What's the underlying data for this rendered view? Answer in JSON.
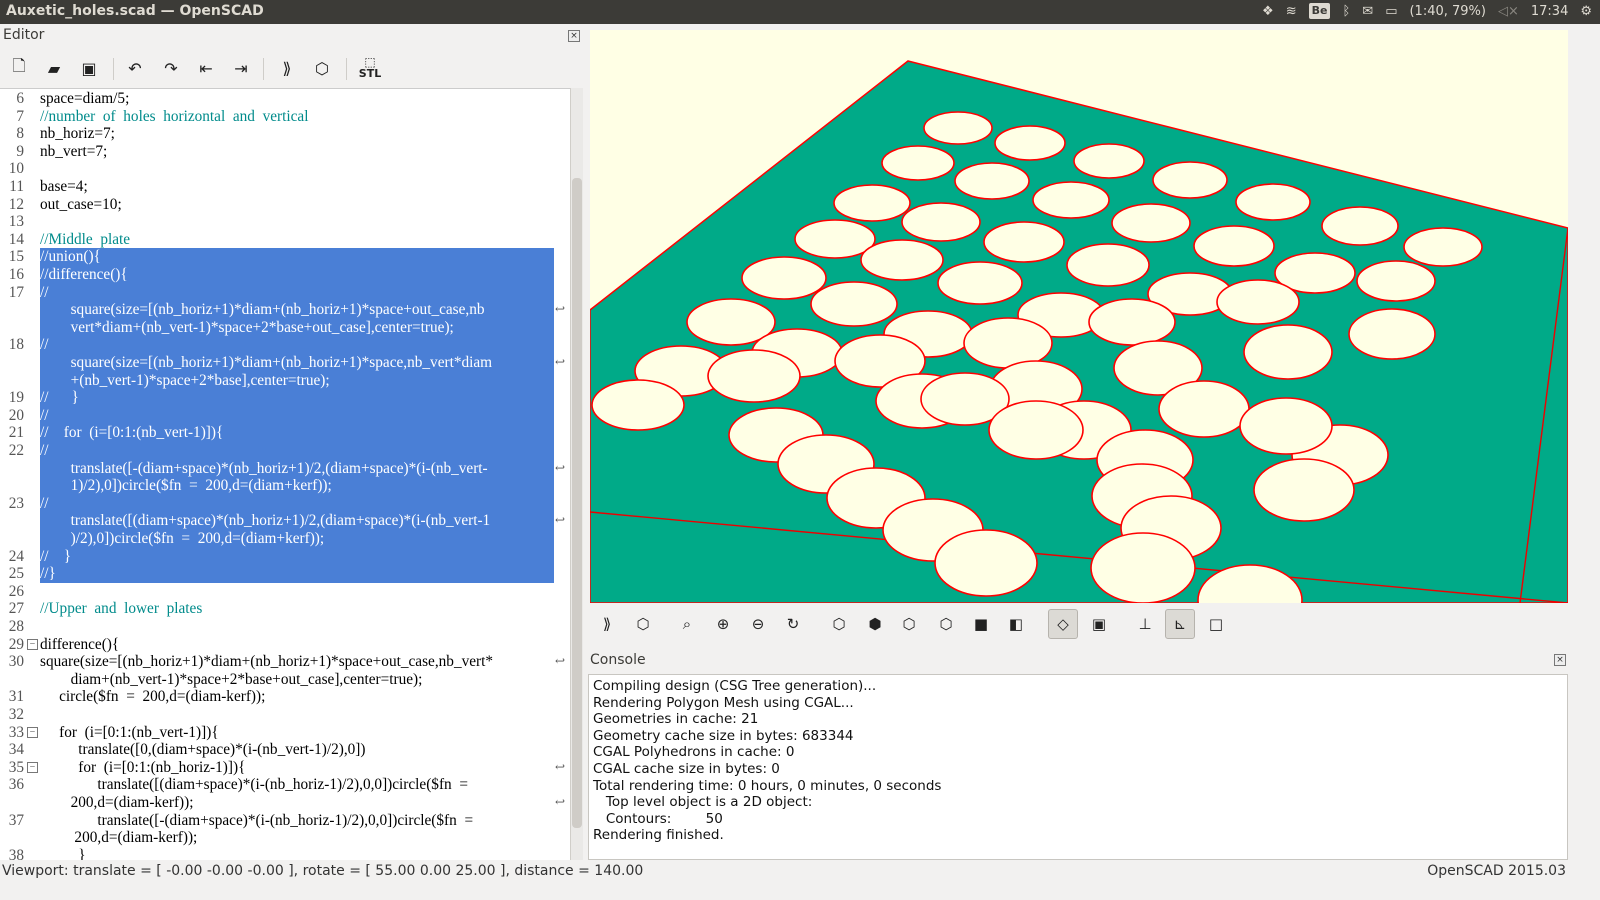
{
  "window": {
    "title": "Auxetic_holes.scad — OpenSCAD"
  },
  "tray": {
    "battery": "(1:40, 79%)",
    "time": "17:34",
    "keyboard": "Be"
  },
  "editor": {
    "title": "Editor",
    "toolbar": [
      "new-file-icon",
      "open-file-icon",
      "save-icon",
      "undo-icon",
      "redo-icon",
      "unindent-icon",
      "indent-icon",
      "preview-icon",
      "render-icon",
      "export-stl-icon"
    ],
    "stl_label": "STL",
    "lines": [
      {
        "n": "6",
        "text": "space=diam/5;",
        "sel": false
      },
      {
        "n": "7",
        "text": "//number  of  holes  horizontal  and  vertical",
        "sel": false,
        "comment": true
      },
      {
        "n": "8",
        "text": "nb_horiz=7;",
        "sel": false
      },
      {
        "n": "9",
        "text": "nb_vert=7;",
        "sel": false
      },
      {
        "n": "10",
        "text": "",
        "sel": false
      },
      {
        "n": "11",
        "text": "base=4;",
        "sel": false
      },
      {
        "n": "12",
        "text": "out_case=10;",
        "sel": false
      },
      {
        "n": "13",
        "text": "",
        "sel": false
      },
      {
        "n": "14",
        "text": "//Middle  plate",
        "sel": false,
        "comment": true
      },
      {
        "n": "15",
        "text": "//union(){",
        "sel": true
      },
      {
        "n": "16",
        "text": "//difference(){",
        "sel": true
      },
      {
        "n": "17",
        "text": "//",
        "sel": true
      },
      {
        "n": "",
        "text": "        square(size=[(nb_horiz+1)*diam+(nb_horiz+1)*space+out_case,nb",
        "sel": true
      },
      {
        "n": "",
        "text": "        vert*diam+(nb_vert-1)*space+2*base+out_case],center=true);",
        "sel": true
      },
      {
        "n": "18",
        "text": "//",
        "sel": true
      },
      {
        "n": "",
        "text": "        square(size=[(nb_horiz+1)*diam+(nb_horiz+1)*space,nb_vert*diam",
        "sel": true
      },
      {
        "n": "",
        "text": "        +(nb_vert-1)*space+2*base],center=true);",
        "sel": true
      },
      {
        "n": "19",
        "text": "//      }",
        "sel": true
      },
      {
        "n": "20",
        "text": "//",
        "sel": true
      },
      {
        "n": "21",
        "text": "//    for  (i=[0:1:(nb_vert-1)]){",
        "sel": true
      },
      {
        "n": "22",
        "text": "//",
        "sel": true
      },
      {
        "n": "",
        "text": "        translate([-(diam+space)*(nb_horiz+1)/2,(diam+space)*(i-(nb_vert-",
        "sel": true
      },
      {
        "n": "",
        "text": "        1)/2),0])circle($fn  =  200,d=(diam+kerf));",
        "sel": true
      },
      {
        "n": "23",
        "text": "//",
        "sel": true
      },
      {
        "n": "",
        "text": "        translate([(diam+space)*(nb_horiz+1)/2,(diam+space)*(i-(nb_vert-1",
        "sel": true
      },
      {
        "n": "",
        "text": "        )/2),0])circle($fn  =  200,d=(diam+kerf));",
        "sel": true
      },
      {
        "n": "24",
        "text": "//    }",
        "sel": true
      },
      {
        "n": "25",
        "text": "//}",
        "sel": true
      },
      {
        "n": "26",
        "text": "",
        "sel": false
      },
      {
        "n": "27",
        "text": "//Upper  and  lower  plates",
        "sel": false,
        "comment": true
      },
      {
        "n": "28",
        "text": "",
        "sel": false
      },
      {
        "n": "29",
        "text": "difference(){",
        "sel": false
      },
      {
        "n": "30",
        "text": "square(size=[(nb_horiz+1)*diam+(nb_horiz+1)*space+out_case,nb_vert*",
        "sel": false
      },
      {
        "n": "",
        "text": "        diam+(nb_vert-1)*space+2*base+out_case],center=true);",
        "sel": false
      },
      {
        "n": "31",
        "text": "     circle($fn  =  200,d=(diam-kerf));",
        "sel": false
      },
      {
        "n": "32",
        "text": "",
        "sel": false
      },
      {
        "n": "33",
        "text": "     for  (i=[0:1:(nb_vert-1)]){",
        "sel": false
      },
      {
        "n": "34",
        "text": "          translate([0,(diam+space)*(i-(nb_vert-1)/2),0])",
        "sel": false
      },
      {
        "n": "35",
        "text": "          for  (i=[0:1:(nb_horiz-1)]){",
        "sel": false
      },
      {
        "n": "36",
        "text": "               translate([(diam+space)*(i-(nb_horiz-1)/2),0,0])circle($fn  =",
        "sel": false
      },
      {
        "n": "",
        "text": "        200,d=(diam-kerf));",
        "sel": false
      },
      {
        "n": "37",
        "text": "               translate([-(diam+space)*(i-(nb_horiz-1)/2),0,0])circle($fn  =",
        "sel": false
      },
      {
        "n": "",
        "text": "         200,d=(diam-kerf));",
        "sel": false
      },
      {
        "n": "38",
        "text": "          }",
        "sel": false
      }
    ]
  },
  "viewport": {
    "background": "#ffffe5",
    "plate_color": "#00aa88",
    "hole_color": "#ffffe5",
    "edge_color": "#ff0000"
  },
  "console": {
    "title": "Console",
    "lines": [
      "Compiling design (CSG Tree generation)...",
      "Rendering Polygon Mesh using CGAL...",
      "Geometries in cache: 21",
      "Geometry cache size in bytes: 683344",
      "CGAL Polyhedrons in cache: 0",
      "CGAL cache size in bytes: 0",
      "Total rendering time: 0 hours, 0 minutes, 0 seconds",
      "   Top level object is a 2D object:",
      "   Contours:        50",
      "Rendering finished."
    ]
  },
  "status": {
    "viewport": "Viewport: translate = [ -0.00 -0.00 -0.00 ], rotate = [ 55.00 0.00 25.00 ], distance = 140.00",
    "version": "OpenSCAD 2015.03"
  }
}
